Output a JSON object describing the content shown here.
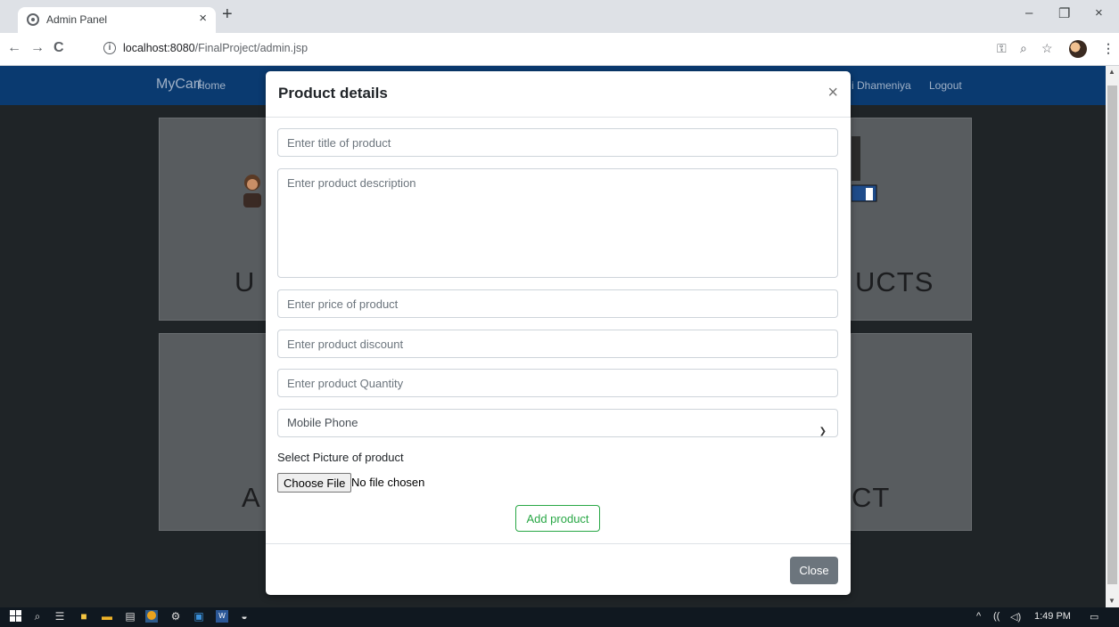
{
  "browser": {
    "tab_title": "Admin Panel",
    "tab_close": "×",
    "new_tab": "+",
    "url_host": "localhost:8080",
    "url_path": "/FinalProject/admin.jsp",
    "window_controls": {
      "minimize": "–",
      "restore": "❐",
      "close": "×"
    },
    "nav": {
      "back": "←",
      "forward": "→",
      "reload": "C"
    },
    "icons": {
      "key": "key-icon",
      "zoom": "zoom-icon",
      "star": "star-icon"
    }
  },
  "site": {
    "brand": "MyCart",
    "nav_home": "Home",
    "nav_user": "i Dhameniya",
    "nav_logout": "Logout",
    "cards": [
      {
        "text": "U"
      },
      {
        "text": "UCTS"
      },
      {
        "text": "A"
      },
      {
        "text": "CT"
      }
    ]
  },
  "modal": {
    "title": "Product details",
    "close_x": "×",
    "title_placeholder": "Enter title of product",
    "description_placeholder": "Enter product description",
    "price_placeholder": "Enter price of product",
    "discount_placeholder": "Enter product discount",
    "quantity_placeholder": "Enter product Quantity",
    "category_selected": "Mobile Phone",
    "picture_label": "Select Picture of product",
    "choose_file": "Choose File",
    "no_file": "No file chosen",
    "add_button": "Add product",
    "close_button": "Close"
  },
  "taskbar": {
    "time": "1:49 PM"
  }
}
